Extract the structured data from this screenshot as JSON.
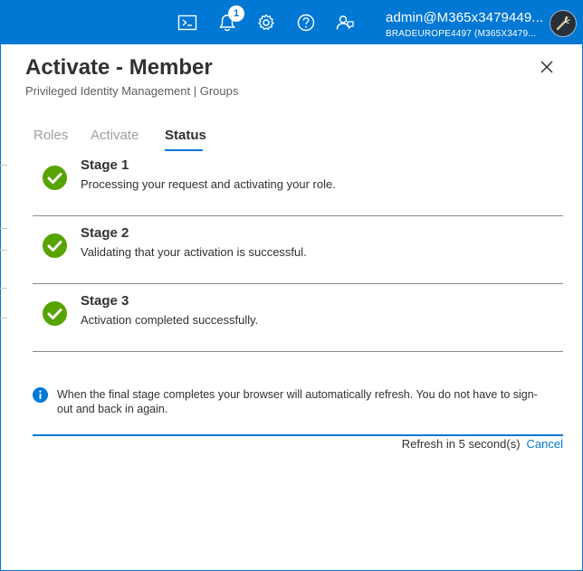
{
  "topbar": {
    "icons": [
      "cloud-shell-icon",
      "notifications-icon",
      "settings-icon",
      "help-icon",
      "feedback-icon"
    ],
    "notification_count": "1",
    "account_user": "admin@M365x3479449...",
    "account_tenant": "BRADEUROPE4497 (M365X3479..."
  },
  "panel": {
    "title": "Activate - Member",
    "subtitle": "Privileged Identity Management | Groups",
    "tabs": [
      {
        "label": "Roles",
        "active": false
      },
      {
        "label": "Activate",
        "active": false
      },
      {
        "label": "Status",
        "active": true
      }
    ],
    "stages": [
      {
        "title": "Stage 1",
        "description": "Processing your request and activating your role."
      },
      {
        "title": "Stage 2",
        "description": "Validating that your activation is successful."
      },
      {
        "title": "Stage 3",
        "description": "Activation completed successfully."
      }
    ],
    "info_text": "When the final stage completes your browser will automatically refresh. You do not have to sign-out and back in again.",
    "refresh_text": "Refresh in 5 second(s)",
    "cancel_label": "Cancel",
    "progress_fraction": 1.0
  },
  "colors": {
    "accent": "#0078d4",
    "success": "#57a300",
    "divider": "#8a8886"
  }
}
